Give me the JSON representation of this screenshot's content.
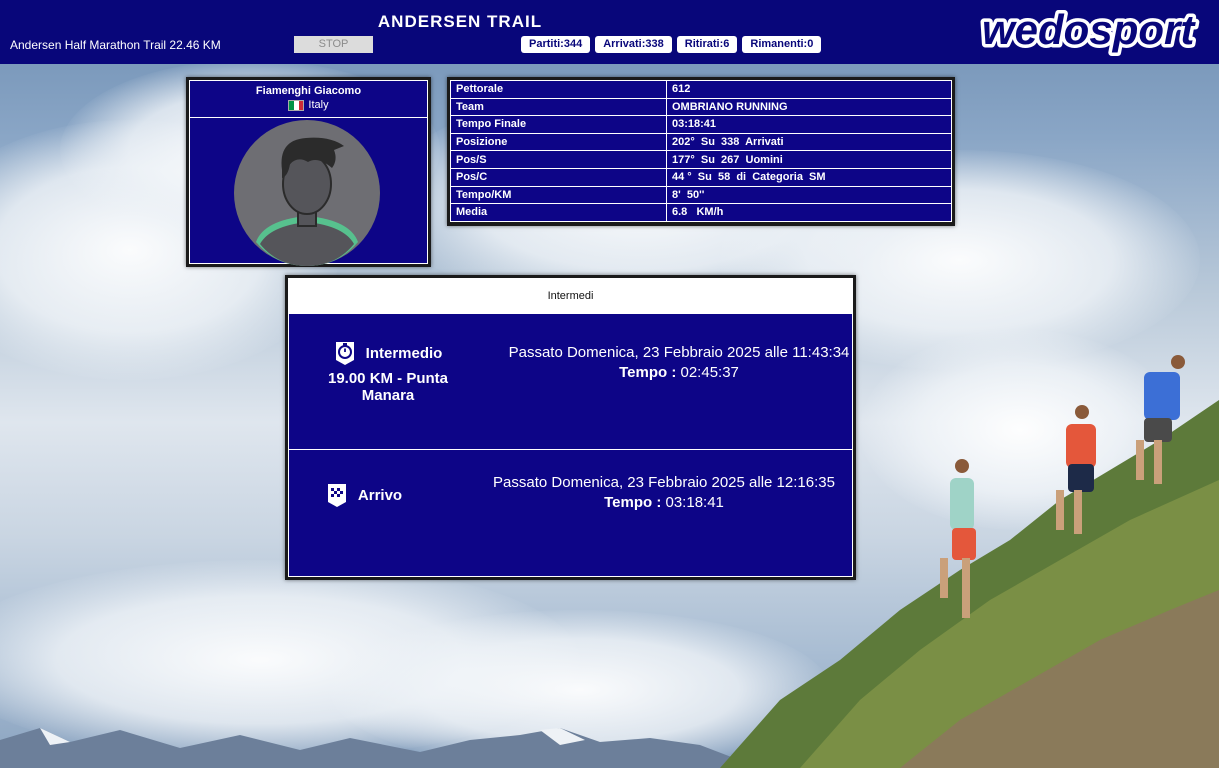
{
  "header": {
    "title": "ANDERSEN TRAIL",
    "race_name": "Andersen Half Marathon Trail 22.46 KM",
    "stop_label": "STOP",
    "stats": [
      "Partiti:344",
      "Arrivati:338",
      "Ritirati:6",
      "Rimanenti:0"
    ],
    "logo_text": "wedosport"
  },
  "athlete": {
    "name": "Fiamenghi Giacomo",
    "country": "Italy",
    "flag_colors": [
      "#009246",
      "#ffffff",
      "#ce2b37"
    ]
  },
  "details": [
    {
      "label": "Pettorale",
      "value": "612"
    },
    {
      "label": "Team",
      "value": "OMBRIANO RUNNING"
    },
    {
      "label": "Tempo Finale",
      "value": "03:18:41"
    },
    {
      "label": "Posizione",
      "value": "202°  Su  338  Arrivati"
    },
    {
      "label": "Pos/S",
      "value": "177°  Su  267  Uomini"
    },
    {
      "label": "Pos/C",
      "value": "44 °  Su  58  di  Categoria  SM"
    },
    {
      "label": "Tempo/KM",
      "value": "8'  50''"
    },
    {
      "label": "Media",
      "value": "6.8   KM/h"
    }
  ],
  "intermedi": {
    "heading": "Intermedi",
    "splits": [
      {
        "icon": "stopwatch-icon",
        "label": "Intermedio",
        "sub": "19.00 KM - Punta Manara",
        "passed": "Passato Domenica, 23 Febbraio 2025 alle 11:43:34",
        "tempo_label": "Tempo :",
        "tempo_value": "02:45:37"
      },
      {
        "icon": "finish-flag-icon",
        "label": "Arrivo",
        "sub": "",
        "passed": "Passato Domenica, 23 Febbraio 2025 alle 12:16:35",
        "tempo_label": "Tempo :",
        "tempo_value": "03:18:41"
      }
    ]
  },
  "colors": {
    "brand_blue": "#08067a",
    "panel_blue": "#0d0587"
  }
}
